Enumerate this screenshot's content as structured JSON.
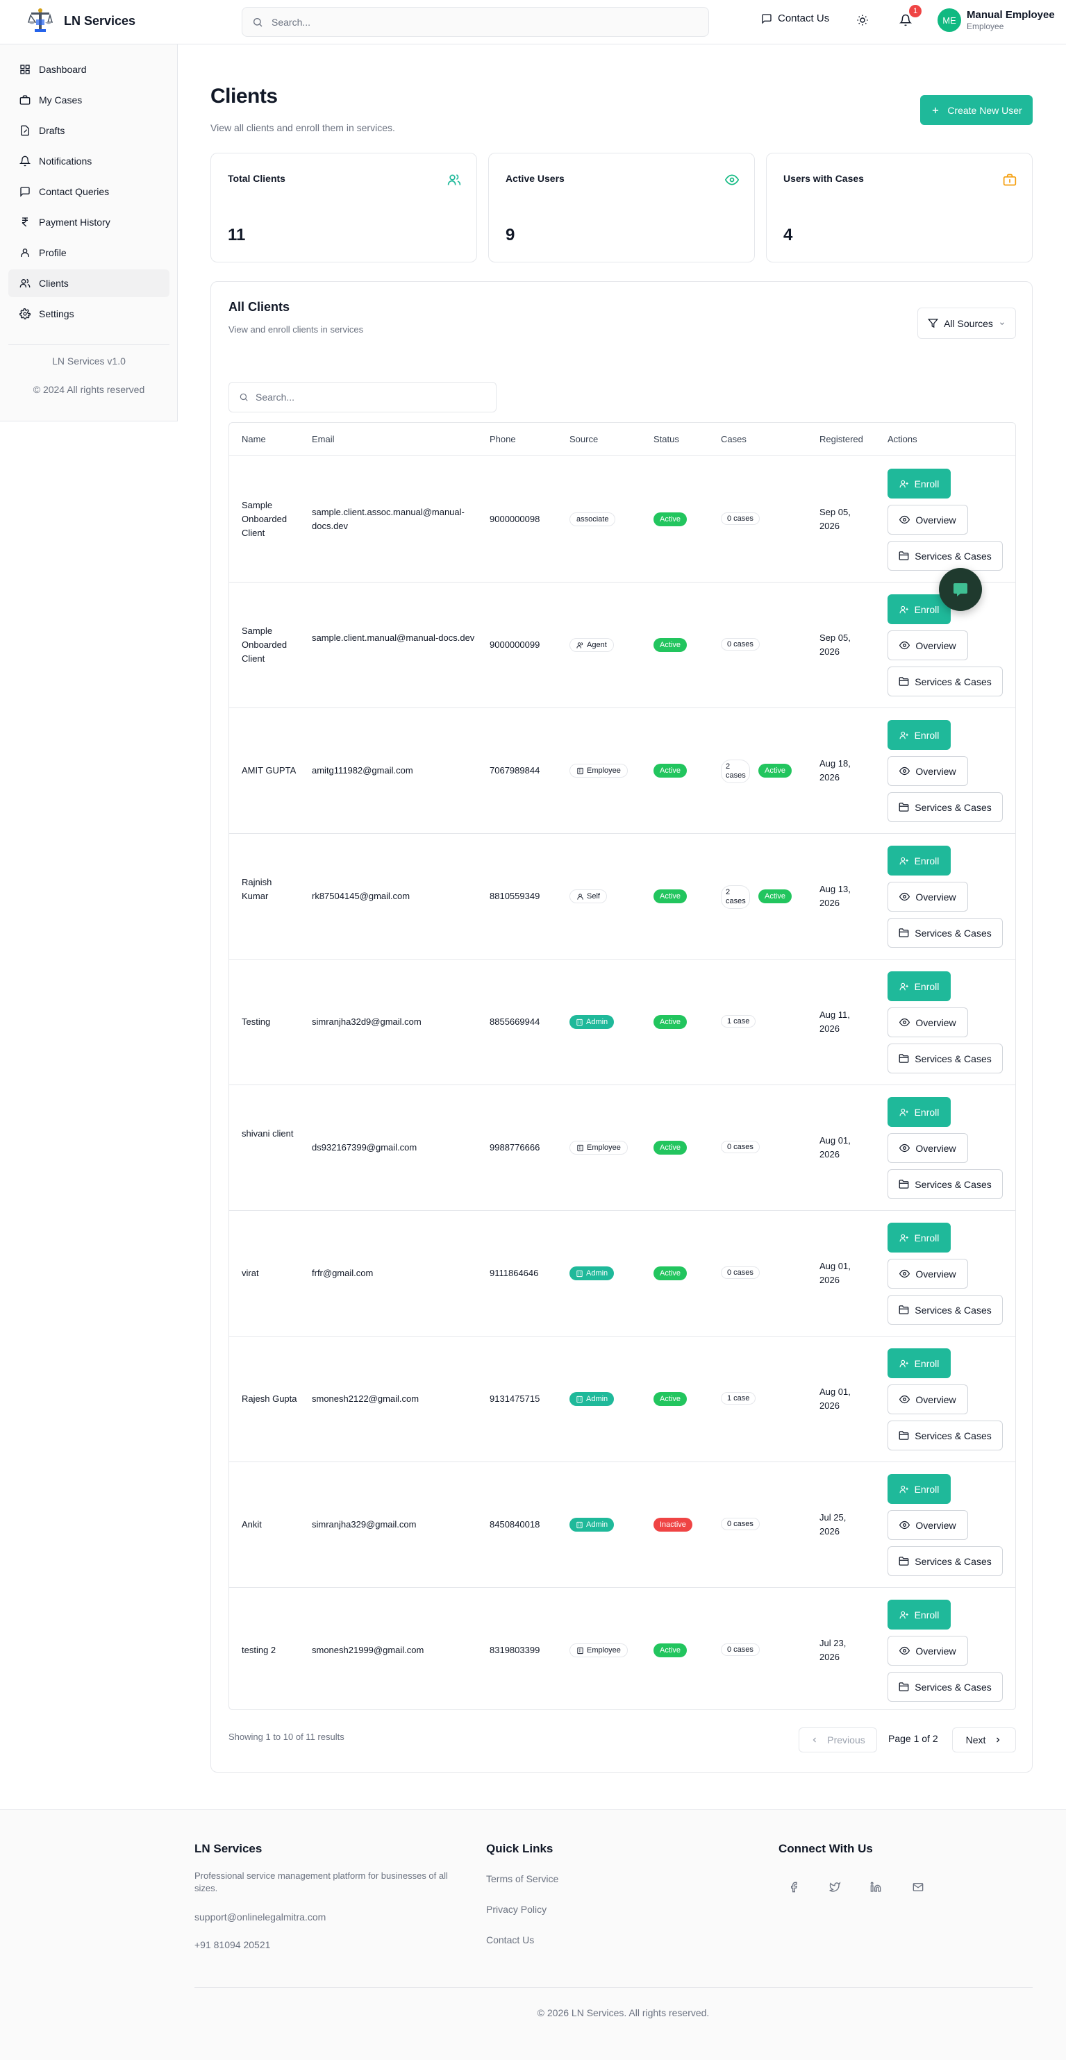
{
  "header": {
    "brand": "LN Services",
    "search_placeholder": "Search...",
    "contact_label": "Contact Us",
    "notification_count": "1",
    "user_initials": "ME",
    "user_name": "Manual Employee",
    "user_role": "Employee"
  },
  "sidebar": {
    "items": [
      {
        "label": "Dashboard",
        "icon": "dashboard-icon"
      },
      {
        "label": "My Cases",
        "icon": "briefcase-icon"
      },
      {
        "label": "Drafts",
        "icon": "drafts-icon"
      },
      {
        "label": "Notifications",
        "icon": "bell-icon"
      },
      {
        "label": "Contact Queries",
        "icon": "message-icon"
      },
      {
        "label": "Payment History",
        "icon": "rupee-icon"
      },
      {
        "label": "Profile",
        "icon": "user-icon"
      },
      {
        "label": "Clients",
        "icon": "users-icon",
        "active": true
      },
      {
        "label": "Settings",
        "icon": "gear-icon"
      }
    ],
    "version": "LN Services v1.0",
    "copyright": "© 2024 All rights reserved"
  },
  "page": {
    "title": "Clients",
    "subtitle": "View all clients and enroll them in services.",
    "create_button": "Create New User"
  },
  "stats": [
    {
      "label": "Total Clients",
      "value": "11",
      "icon": "users-icon"
    },
    {
      "label": "Active Users",
      "value": "9",
      "icon": "eye-icon"
    },
    {
      "label": "Users with Cases",
      "value": "4",
      "icon": "briefcase-icon"
    }
  ],
  "clients_card": {
    "title": "All Clients",
    "subtitle": "View and enroll clients in services",
    "filter_label": "All Sources",
    "search_placeholder": "Search..."
  },
  "table": {
    "columns": [
      "Name",
      "Email",
      "Phone",
      "Source",
      "Status",
      "Cases",
      "Registered",
      "Actions"
    ],
    "actions": {
      "enroll": "Enroll",
      "overview": "Overview",
      "services": "Services & Cases"
    },
    "rows": [
      {
        "name": "Sample Onboarded Client",
        "email": "sample.client.assoc.manual@manual-docs.dev",
        "phone": "9000000098",
        "source": "associate",
        "source_style": "outline",
        "source_icon": "",
        "status": "Active",
        "cases": "0 cases",
        "case_badge": "",
        "registered": "Sep 05, 2026"
      },
      {
        "name": "Sample Onboarded Client",
        "email": "sample.client.manual@manual-docs.dev",
        "phone": "9000000099",
        "source": "Agent",
        "source_style": "outline",
        "source_icon": "users",
        "status": "Active",
        "cases": "0 cases",
        "case_badge": "",
        "registered": "Sep 05, 2026"
      },
      {
        "name": "AMIT GUPTA",
        "email": "amitg111982@gmail.com",
        "phone": "7067989844",
        "source": "Employee",
        "source_style": "outline",
        "source_icon": "building",
        "status": "Active",
        "cases": "2 cases",
        "case_badge": "Active",
        "registered": "Aug 18, 2026"
      },
      {
        "name": "Rajnish Kumar",
        "email": "rk87504145@gmail.com",
        "phone": "8810559349",
        "source": "Self",
        "source_style": "outline",
        "source_icon": "user",
        "status": "Active",
        "cases": "2 cases",
        "case_badge": "Active",
        "registered": "Aug 13, 2026"
      },
      {
        "name": "Testing",
        "email": "simranjha32d9@gmail.com",
        "phone": "8855669944",
        "source": "Admin",
        "source_style": "teal",
        "source_icon": "building",
        "status": "Active",
        "cases": "1 case",
        "case_badge": "",
        "registered": "Aug 11, 2026"
      },
      {
        "name": "shivani client",
        "email": "ds932167399@gmail.com",
        "phone": "9988776666",
        "source": "Employee",
        "source_style": "outline",
        "source_icon": "building",
        "status": "Active",
        "cases": "0 cases",
        "case_badge": "",
        "registered": "Aug 01, 2026"
      },
      {
        "name": "virat",
        "email": "frfr@gmail.com",
        "phone": "9111864646",
        "source": "Admin",
        "source_style": "teal",
        "source_icon": "building",
        "status": "Active",
        "cases": "0 cases",
        "case_badge": "",
        "registered": "Aug 01, 2026"
      },
      {
        "name": "Rajesh Gupta",
        "email": "smonesh2122@gmail.com",
        "phone": "9131475715",
        "source": "Admin",
        "source_style": "teal",
        "source_icon": "building",
        "status": "Active",
        "cases": "1 case",
        "case_badge": "",
        "registered": "Aug 01, 2026"
      },
      {
        "name": "Ankit",
        "email": "simranjha329@gmail.com",
        "phone": "8450840018",
        "source": "Admin",
        "source_style": "teal",
        "source_icon": "building",
        "status": "Inactive",
        "cases": "0 cases",
        "case_badge": "",
        "registered": "Jul 25, 2026"
      },
      {
        "name": "testing 2",
        "email": "smonesh21999@gmail.com",
        "phone": "8319803399",
        "source": "Employee",
        "source_style": "outline",
        "source_icon": "building",
        "status": "Active",
        "cases": "0 cases",
        "case_badge": "",
        "registered": "Jul 23, 2026"
      }
    ]
  },
  "pagination": {
    "showing": "Showing 1 to 10 of 11 results",
    "previous": "Previous",
    "page_label": "Page 1 of 2",
    "next": "Next"
  },
  "footer": {
    "brand": "LN Services",
    "description": "Professional service management platform for businesses of all sizes.",
    "email": "support@onlinelegalmitra.com",
    "phone": "+91 81094 20521",
    "quick_links_title": "Quick Links",
    "links": [
      "Terms of Service",
      "Privacy Policy",
      "Contact Us"
    ],
    "connect_title": "Connect With Us",
    "social": [
      "facebook-icon",
      "twitter-icon",
      "linkedin-icon",
      "mail-icon"
    ],
    "copyright": "© 2026 LN Services. All rights reserved."
  },
  "colors": {
    "accent": "#1fb99a",
    "active_status": "#22c55e",
    "inactive_status": "#ef4444",
    "chat_fab": "#1f3a2e",
    "stat_icon_users": "#1fb99a",
    "stat_icon_eye": "#10b981",
    "stat_icon_case": "#f59e0b"
  }
}
